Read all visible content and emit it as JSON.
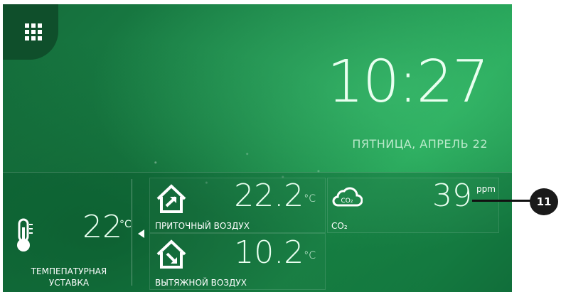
{
  "menu": {
    "icon": "grid-menu-icon"
  },
  "clock": {
    "time": "10:27",
    "date": "ПЯТНИЦА, АПРЕЛЬ 22"
  },
  "setpoint": {
    "value": "22",
    "unit": "°C",
    "label_line1": "ТЕМПЕПАТУРНАЯ",
    "label_line2": "УСТАВКА"
  },
  "supply_air": {
    "value": "22.2",
    "unit": "°C",
    "label": "ПРИТОЧНЫЙ ВОЗДУХ"
  },
  "exhaust_air": {
    "value": "10.2",
    "unit": "°C",
    "label": "ВЫТЯЖНОЙ ВОЗДУХ"
  },
  "co2": {
    "value": "39",
    "unit": "ppm",
    "label": "CO₂",
    "icon_text": "CO₂"
  },
  "callout": {
    "label": "11"
  },
  "colors": {
    "bg_dark": "#0f4f2b",
    "bg_main": "#1c8a4b",
    "bg_light": "#23a457"
  }
}
